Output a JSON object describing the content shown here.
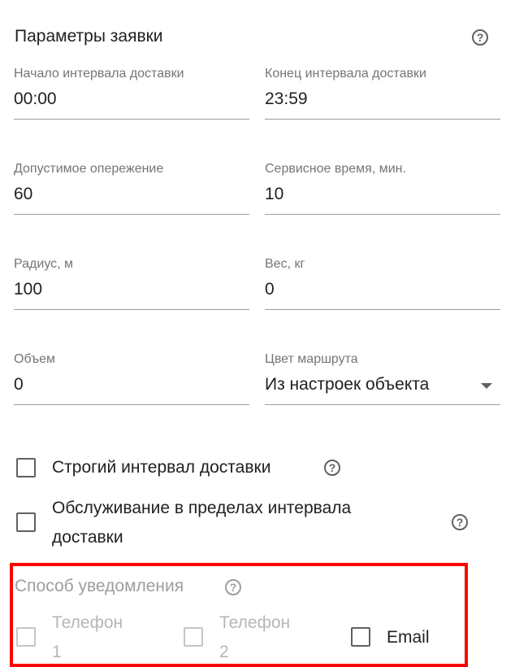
{
  "header": {
    "title": "Параметры заявки",
    "help_icon": "question-circle-icon"
  },
  "fields": [
    {
      "label": "Начало интервала доставки",
      "value": "00:00"
    },
    {
      "label": "Конец интервала доставки",
      "value": "23:59"
    },
    {
      "label": "Допустимое опережение",
      "value": "60"
    },
    {
      "label": "Сервисное время, мин.",
      "value": "10"
    },
    {
      "label": "Радиус, м",
      "value": "100"
    },
    {
      "label": "Вес, кг",
      "value": "0"
    },
    {
      "label": "Объем",
      "value": "0"
    },
    {
      "label": "Цвет маршрута",
      "value": "Из настроек объекта"
    }
  ],
  "checkboxes": {
    "strict_interval": {
      "label": "Строгий интервал доставки",
      "checked": false
    },
    "service_within_interval": {
      "label_line1": "Обслуживание в пределах интервала",
      "label_line2": "доставки",
      "checked": false
    }
  },
  "notification": {
    "label": "Способ уведомления",
    "options": [
      {
        "label_line1": "Телефон",
        "label_line2": "1",
        "checked": false,
        "disabled": true
      },
      {
        "label_line1": "Телефон",
        "label_line2": "2",
        "checked": false,
        "disabled": true
      },
      {
        "label": "Email",
        "checked": false,
        "disabled": false
      }
    ]
  },
  "colors": {
    "highlight": "#ff0000",
    "text": "#212121",
    "label": "#757575",
    "disabled": "#b6b6b6"
  }
}
